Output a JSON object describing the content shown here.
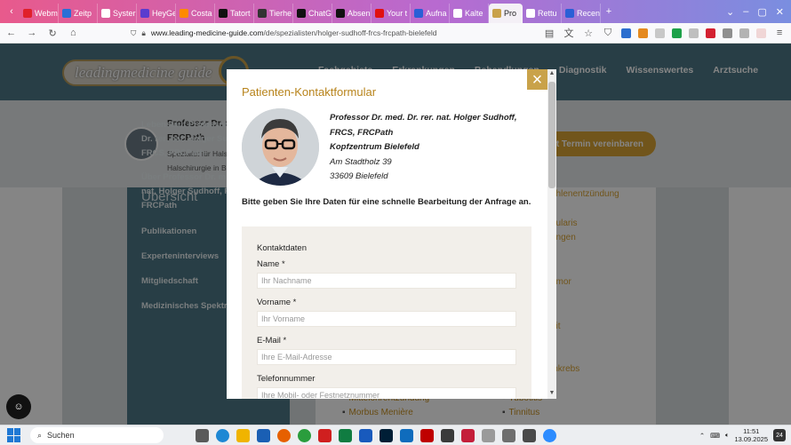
{
  "browser": {
    "tabs": [
      {
        "label": "Webm",
        "color": "#e0202a"
      },
      {
        "label": "Zeitp",
        "color": "#2a6fd6"
      },
      {
        "label": "Syster",
        "color": "#ffffff"
      },
      {
        "label": "HeyGe",
        "color": "#5a3ccf"
      },
      {
        "label": "Costa",
        "color": "#ff8a00"
      },
      {
        "label": "Tatort",
        "color": "#111111"
      },
      {
        "label": "Tierhe",
        "color": "#333333"
      },
      {
        "label": "ChatG",
        "color": "#111111"
      },
      {
        "label": "Absen",
        "color": "#111111"
      },
      {
        "label": "Your t",
        "color": "#e01010"
      },
      {
        "label": "Aufna",
        "color": "#2a5fd6"
      },
      {
        "label": "Kalte",
        "color": "#ffffff"
      },
      {
        "label": "Pro",
        "color": "#c9a24a",
        "active": true
      },
      {
        "label": "Rettu",
        "color": "#ffffff"
      },
      {
        "label": "Recen",
        "color": "#2a5fd6"
      }
    ],
    "new_tab": "+",
    "url_host": "www.leading-medicine-guide.com",
    "url_path": "/de/spezialisten/holger-sudhoff-frcs-frcpath-bielefeld"
  },
  "site": {
    "logo": "leadingmedicine guide",
    "menu": [
      "Fachgebiete",
      "Erkrankungen",
      "Behandlungen",
      "Diagnostik",
      "Wissenswertes",
      "Arztsuche"
    ],
    "profile_name_line1": "Professor Dr. m",
    "profile_name_line2": "FRCPath",
    "profile_sub_line1": "Spezialist für Hals",
    "profile_sub_line2": "Halschirurgie in Bi",
    "termin_button": "zt Termin vereinbaren",
    "sidebar_title": "Übersicht",
    "sidebar_items": [
      {
        "l1": "Lebenslauf Professor",
        "l2": "Dr. rer. nat. Holger Su",
        "l3": "FRCS, FRCPath"
      },
      {
        "l1": "Über Professor Dr. m",
        "l2": "nat. Holger Sudhoff, F",
        "l3": "FRCPath"
      },
      {
        "l1": "Publikationen"
      },
      {
        "l1": "Experteninterviews"
      },
      {
        "l1": "Mitgliedschaft"
      },
      {
        "l1": "Medizinisches Spektrum"
      }
    ],
    "right_links": [
      "öhlenentzündung",
      "bularis",
      "ungen",
      "umor",
      "eit",
      "inkrebs"
    ],
    "bottom_links": [
      "Mittelohrentzündung",
      "Morbus Menière",
      "Tubotitis",
      "Tinnitus"
    ]
  },
  "modal": {
    "title": "Patienten-Kontaktformular",
    "close_icon": "×",
    "doctor_line1": "Professor Dr. med. Dr. rer. nat. Holger Sudhoff,",
    "doctor_line2": "FRCS, FRCPath",
    "clinic": "Kopfzentrum Bielefeld",
    "street": "Am Stadtholz 39",
    "city": "33609 Bielefeld",
    "intro": "Bitte geben Sie Ihre Daten für eine schnelle Bearbeitung der Anfrage an.",
    "form": {
      "section": "Kontaktdaten",
      "name_label": "Name *",
      "name_placeholder": "Ihr Nachname",
      "firstname_label": "Vorname *",
      "firstname_placeholder": "Ihr Vorname",
      "email_label": "E-Mail *",
      "email_placeholder": "Ihre E-Mail-Adresse",
      "phone_label": "Telefonnummer",
      "phone_placeholder": "Ihre Mobil- oder Festnetznummer"
    }
  },
  "taskbar": {
    "search_label": "Suchen",
    "time": "11:51",
    "date": "13.09.2025",
    "notifications": "24"
  }
}
